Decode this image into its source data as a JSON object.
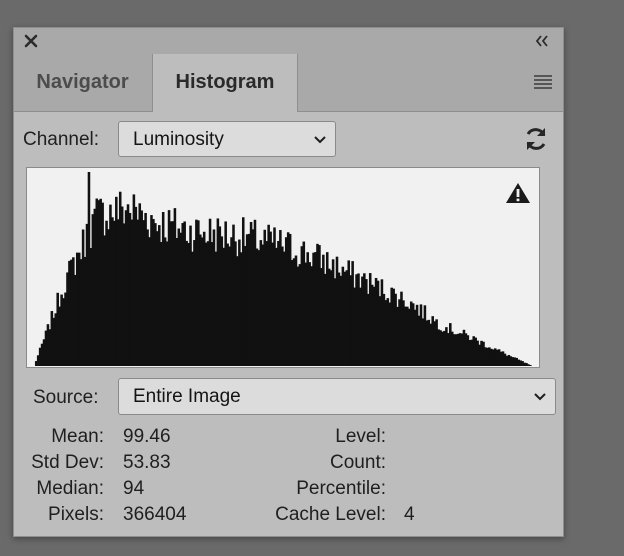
{
  "panel": {
    "tabs": [
      {
        "label": "Navigator",
        "active": false
      },
      {
        "label": "Histogram",
        "active": true
      }
    ]
  },
  "channel": {
    "label": "Channel:",
    "value": "Luminosity"
  },
  "source": {
    "label": "Source:",
    "value": "Entire Image"
  },
  "stats": {
    "mean": {
      "label": "Mean:",
      "value": "99.46"
    },
    "std_dev": {
      "label": "Std Dev:",
      "value": "53.83"
    },
    "median": {
      "label": "Median:",
      "value": "94"
    },
    "pixels": {
      "label": "Pixels:",
      "value": "366404"
    },
    "level": {
      "label": "Level:",
      "value": ""
    },
    "count": {
      "label": "Count:",
      "value": ""
    },
    "percentile": {
      "label": "Percentile:",
      "value": ""
    },
    "cache_level": {
      "label": "Cache Level:",
      "value": "4"
    }
  },
  "icons": {
    "close": "close-icon",
    "collapse": "double-chevron-left-icon",
    "menu": "hamburger-menu-icon",
    "refresh": "refresh-icon",
    "warning": "warning-triangle-icon"
  },
  "colors": {
    "panel_bg": "#bdbdbd",
    "histogram_fill": "#111111",
    "histogram_bg": "#f1f1f1"
  },
  "chart_data": {
    "type": "area",
    "x": [
      0,
      16,
      32,
      48,
      64,
      80,
      96,
      112,
      128,
      144,
      160,
      176,
      192,
      208,
      224,
      240,
      255
    ],
    "values": [
      0.0,
      0.45,
      0.8,
      0.84,
      0.76,
      0.72,
      0.7,
      0.68,
      0.64,
      0.58,
      0.5,
      0.42,
      0.34,
      0.22,
      0.15,
      0.07,
      0.0
    ],
    "peak_x": 28,
    "xlim": [
      0,
      255
    ],
    "ylim": [
      0,
      1
    ],
    "grid": false,
    "legend": "none"
  }
}
